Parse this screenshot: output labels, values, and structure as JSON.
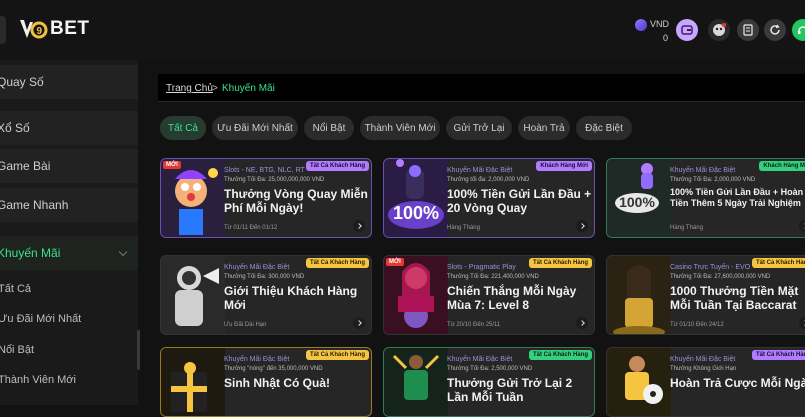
{
  "header": {
    "logo_text": "BET",
    "currency": "VND",
    "balance": "0"
  },
  "sidebar": {
    "items": [
      {
        "label": "Quay Số"
      },
      {
        "label": "Xổ Số"
      },
      {
        "label": "Game Bài"
      },
      {
        "label": "Game Nhanh"
      },
      {
        "label": "Khuyến Mãi"
      }
    ],
    "sub": [
      "Tất Cả",
      "Ưu Đãi Mới Nhất",
      "Nổi Bật",
      "Thành Viên Mới"
    ]
  },
  "breadcrumb": {
    "home": "Trang Chủ",
    "sep": ">",
    "current": "Khuyến Mãi"
  },
  "chips": [
    "Tất Cả",
    "Ưu Đãi Mới Nhất",
    "Nổi Bật",
    "Thành Viên Mới",
    "Gửi Trở Lại",
    "Hoàn Trả",
    "Đặc Biệt"
  ],
  "cards": [
    {
      "new": "MỚI",
      "tag": "Tất Cả Khách Hàng",
      "cat": "Slots - NE, BTG, NLC, RT",
      "max": "Thưởng Tối Đa: 25,000,000,000 VND",
      "title": "Thưởng Vòng Quay Miễn Phí Mỗi Ngày!",
      "date": "Từ 01/11 Đến 01/12"
    },
    {
      "new": "",
      "tag": "Khách Hàng Mới",
      "cat": "Khuyến Mãi Đặc Biệt",
      "max": "Thưởng tối đa: 2,000,000 VND",
      "title": "100% Tiền Gửi Lần Đầu + 20 Vòng Quay",
      "date": "Hàng Tháng",
      "art_text": "100%"
    },
    {
      "new": "",
      "tag": "Khách Hàng Mới",
      "cat": "Khuyến Mãi Đặc Biệt",
      "max": "Thưởng Tối Đa: 2,000,000 VND",
      "title": "100% Tiền Gửi Lần Đầu + Hoàn Tiền Thêm 5 Ngày Trải Nghiệm",
      "date": "Hàng Tháng",
      "art_text": "100%"
    },
    {
      "new": "",
      "tag": "Tất Cả Khách Hàng",
      "cat": "Khuyến Mãi Đặc Biệt",
      "max": "Thưởng Tối Đa: 300,000 VND",
      "title": "Giới Thiệu Khách Hàng Mới",
      "date": "Ưu Đãi Dài Hạn"
    },
    {
      "new": "MỚI",
      "tag": "Tất Cả Khách Hàng",
      "cat": "Slots - Pragmatic Play",
      "max": "Thưởng Tối Đa: 221,400,000 VND",
      "title": "Chiến Thắng Mỗi Ngày Mùa 7: Level 8",
      "date": "Từ 20/10 Đến 25/11"
    },
    {
      "new": "",
      "tag": "Tất Cả Khách Hàng",
      "cat": "Casino Trực Tuyến - EVO",
      "max": "Thưởng Tối Đa: 27,600,000,000 VND",
      "title": "1000 Thưởng Tiền Mặt Mỗi Tuần Tại Baccarat",
      "date": "Từ 01/10 Đến 24/12"
    },
    {
      "new": "",
      "tag": "Tất Cả Khách Hàng",
      "cat": "Khuyến Mãi Đặc Biệt",
      "max": "Thưởng \"nóng\" đến 35,000,000 VND",
      "title": "Sinh Nhật Có Quà!",
      "date": ""
    },
    {
      "new": "",
      "tag": "Tất Cả Khách Hàng",
      "cat": "Khuyến Mãi Đặc Biệt",
      "max": "Thưởng Tối Đa: 2,500,000 VND",
      "title": "Thưởng Gửi Trở Lại 2 Lần Mỗi Tuần",
      "date": ""
    },
    {
      "new": "",
      "tag": "Tất Cả Khách Hàng",
      "cat": "Khuyến Mãi Đặc Biệt",
      "max": "Thưởng Không Giới Hạn",
      "title": "Hoàn Trả Cược Mỗi Ngày",
      "date": ""
    }
  ],
  "colors": {
    "accent": "#3ee08a",
    "purple": "#b17cff",
    "yellow": "#f5c542"
  }
}
